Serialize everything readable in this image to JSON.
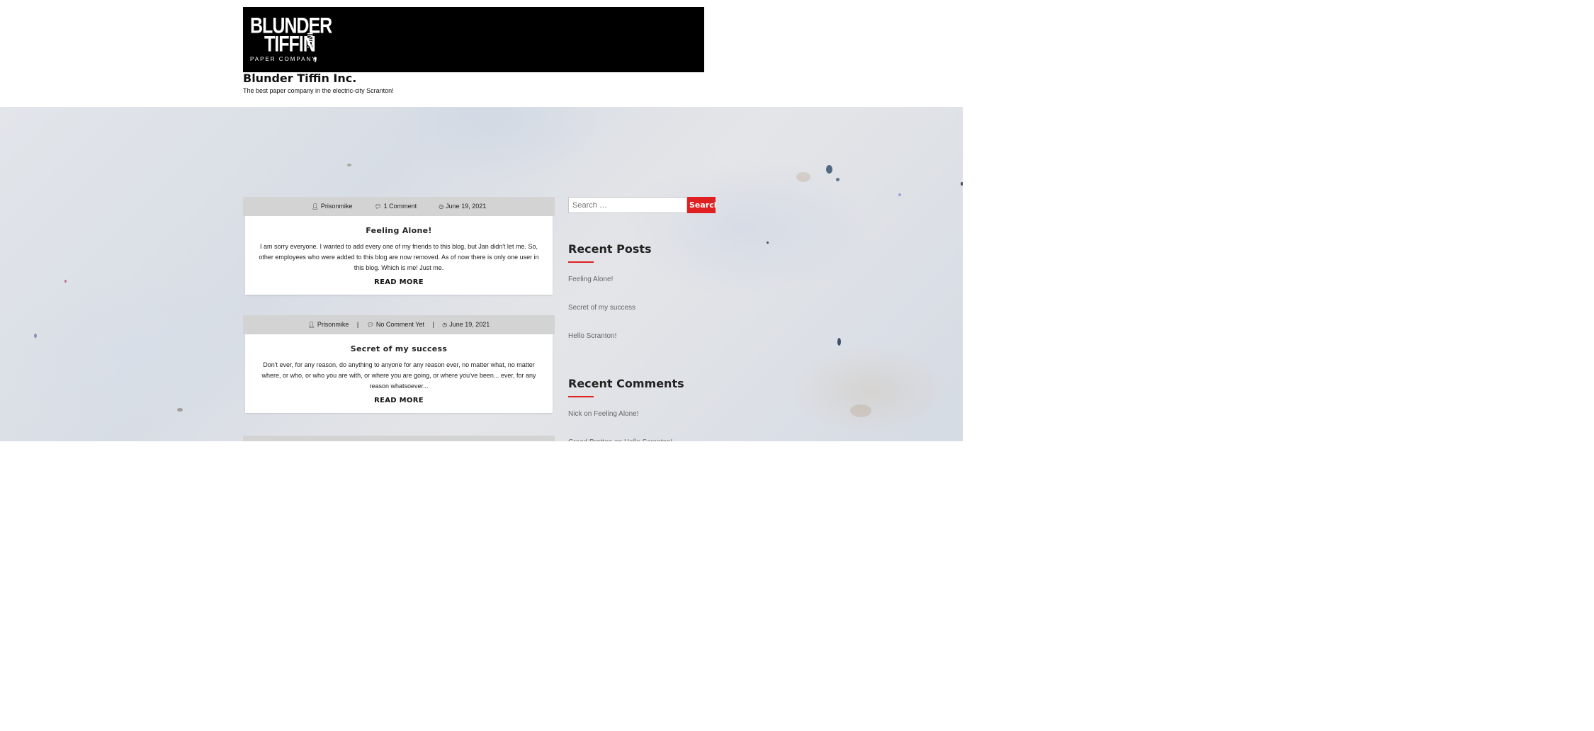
{
  "header": {
    "logo": {
      "line1": "BLUNDER",
      "line2": "TIFFIN",
      "suffix": "INC.",
      "line3": "PAPER COMPANY"
    },
    "site_title": "Blunder Tiffin Inc.",
    "tagline": "The best paper company in the electric-city Scranton!"
  },
  "posts": [
    {
      "author": "Prisonmike",
      "comments": "1 Comment",
      "date": "June 19, 2021",
      "title": "Feeling Alone!",
      "excerpt": "I am sorry everyone. I wanted to add every one of my friends to this blog, but Jan didn't let me. So, other employees who were added to this blog are now removed. As of now there is only one user in this blog. Which is me! Just me.",
      "read_more": "READ MORE"
    },
    {
      "author": "Prisonmike",
      "comments": "No Comment Yet",
      "date": "June 19, 2021",
      "separator": "|",
      "title": "Secret of my success",
      "excerpt": "Don't ever, for any reason, do anything to anyone for any reason ever, no matter what, no matter where, or who, or who you are with, or where you are going, or where you've been... ever, for any reason whatsoever...",
      "read_more": "READ MORE"
    }
  ],
  "sidebar": {
    "search": {
      "placeholder": "Search …",
      "button_label": "Search"
    },
    "recent_posts": {
      "title": "Recent Posts",
      "items": [
        "Feeling Alone!",
        "Secret of my success",
        "Hello Scranton!"
      ]
    },
    "recent_comments": {
      "title": "Recent Comments",
      "items": [
        {
          "author": "Nick",
          "on": "on",
          "post": "Feeling Alone!"
        },
        {
          "author": "Creed Bratton",
          "on": "on",
          "post": "Hello Scranton!"
        }
      ]
    }
  },
  "icons": {
    "author": "user-icon",
    "comments": "comments-icon",
    "date": "clock-icon"
  },
  "colors": {
    "accent": "#e02020",
    "meta_bar": "#d3d3d3",
    "logo_bg": "#000000"
  }
}
